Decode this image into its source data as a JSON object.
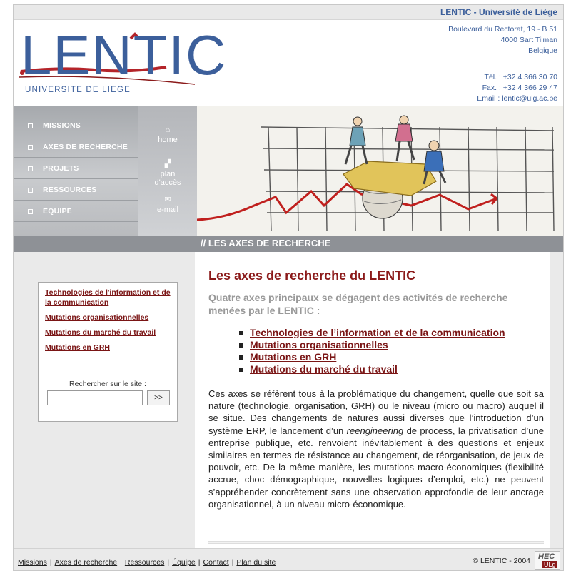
{
  "top_bar": {
    "title": "LENTIC - Université de Liège"
  },
  "logo": {
    "word": "LENTIC",
    "subtitle": "UNIVERSITE DE LIEGE"
  },
  "address": {
    "line1": "Boulevard du Rectorat, 19 - B 51",
    "line2": "4000 Sart Tilman",
    "line3": "Belgique",
    "tel": "Tél. : +32 4 366 30 70",
    "fax": "Fax. : +32 4 366 29 47",
    "email": "Email : lentic@ulg.ac.be"
  },
  "nav": {
    "items": [
      {
        "label": "MISSIONS"
      },
      {
        "label": "AXES DE RECHERCHE"
      },
      {
        "label": "PROJETS"
      },
      {
        "label": "RESSOURCES"
      },
      {
        "label": "EQUIPE"
      }
    ]
  },
  "quick": {
    "home": "home",
    "plan1": "plan",
    "plan2": "d'accès",
    "email": "e-mail"
  },
  "section_title": "// LES AXES DE RECHERCHE",
  "sidebar": {
    "links": [
      "Technologies de l'information et de la communication",
      "Mutations organisationnelles",
      "Mutations du marché du travail",
      "Mutations en GRH"
    ],
    "search_label": "Rechercher sur le site :",
    "search_value": "",
    "search_button": ">>"
  },
  "content": {
    "heading": "Les axes de recherche du LENTIC",
    "lead": "Quatre axes principaux se dégagent des activités de recherche menées par le LENTIC :",
    "list": [
      "Technologies de l’information et de la communication",
      "Mutations organisationnelles",
      "Mutations en GRH",
      "Mutations du marché du travail"
    ],
    "body_a": "Ces axes se réfèrent tous à la problématique du changement, quelle que soit sa nature (technologie, organisation, GRH) ou le niveau (micro ou macro) auquel il se situe. Des changements de natures aussi diverses que l’introduction d’un système ERP, le lancement d’un ",
    "body_em": "reengineering",
    "body_b": " de process, la privatisation d’une entreprise publique, etc. renvoient inévitablement à des questions et enjeux similaires en termes de résistance au changement, de réorganisation, de jeux de pouvoir, etc. De la même manière, les mutations macro-économiques (flexibilité accrue, choc démographique, nouvelles logiques d’emploi, etc.) ne peuvent s’appréhender concrètement sans une observation approfondie de leur ancrage organisationnel, à un niveau micro-économique."
  },
  "footer": {
    "links": [
      "Missions",
      "Axes de recherche",
      "Ressources",
      "Équipe",
      "Contact",
      "Plan du site"
    ],
    "sep": "|",
    "copyright": "© LENTIC - 2004",
    "hec_logo": "HEC",
    "ulg_logo": "ULg"
  },
  "colors": {
    "brand_blue": "#3c5f9b",
    "accent_red": "#8b1a1a",
    "bar_gray": "#8e9196"
  },
  "icons": {
    "home": "house-icon",
    "plan": "sitemap-icon",
    "email": "envelope-icon"
  }
}
